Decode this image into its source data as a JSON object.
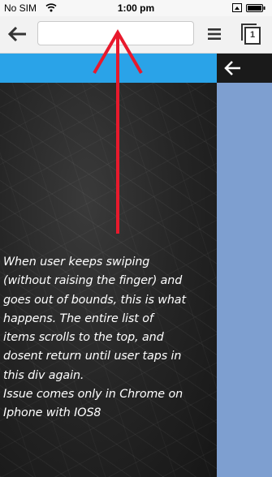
{
  "status_bar": {
    "carrier": "No SIM",
    "time": "1:00 pm",
    "icons": [
      "wifi-icon",
      "rotation-lock-icon",
      "battery-icon"
    ]
  },
  "toolbar": {
    "omnibox_value": "",
    "tabs_count": "1",
    "icons": [
      "back-arrow-icon",
      "menu-icon",
      "tabs-icon"
    ]
  },
  "page": {
    "header_color": "#2aa3e8",
    "side_panel_color": "#7e9fd0",
    "note": "When user keeps swiping\n(without raising the finger) and\ngoes out of bounds, this is what\nhappens. The entire list of\nitems scrolls to the top, and\ndosent return until user taps in\nthis div again.\nIssue comes only in Chrome on\nIphone with IOS8"
  },
  "annotation": {
    "color": "#e8192c"
  }
}
